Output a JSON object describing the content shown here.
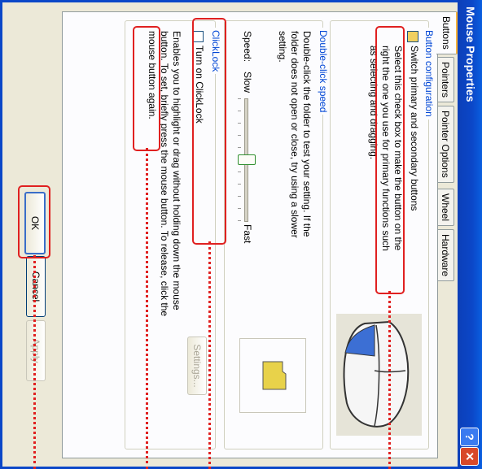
{
  "window": {
    "title": "Mouse Properties",
    "help_glyph": "?",
    "close_glyph": "✕"
  },
  "tabs": [
    {
      "label": "Buttons"
    },
    {
      "label": "Pointers"
    },
    {
      "label": "Pointer Options"
    },
    {
      "label": "Wheel"
    },
    {
      "label": "Hardware"
    }
  ],
  "button_config": {
    "legend": "Button configuration",
    "checkbox_label": "Switch primary and secondary buttons",
    "description_lines": [
      "Select this check box to make the button on the",
      "right the one you use for primary functions such",
      "as selecting and dragging."
    ]
  },
  "double_click": {
    "legend": "Double-click speed",
    "description_lines": [
      "Double-click the folder to test your setting. If the",
      "folder does not open or close, try using a slower",
      "setting."
    ],
    "speed_label": "Speed:",
    "slow_label": "Slow",
    "fast_label": "Fast",
    "slider_level": 0.5
  },
  "clicklock": {
    "legend": "ClickLock",
    "checkbox_label": "Turn on ClickLock",
    "settings_label": "Settings...",
    "description_lines": [
      "Enables you to highlight or drag without holding down the mouse",
      "button. To set, briefly press the mouse button. To release, click the",
      "mouse button again."
    ]
  },
  "buttons": {
    "ok": "OK",
    "cancel": "Cancel",
    "apply": "Apply"
  },
  "colors": {
    "highlight_box": "#e02020",
    "accent": "#0046d5"
  }
}
